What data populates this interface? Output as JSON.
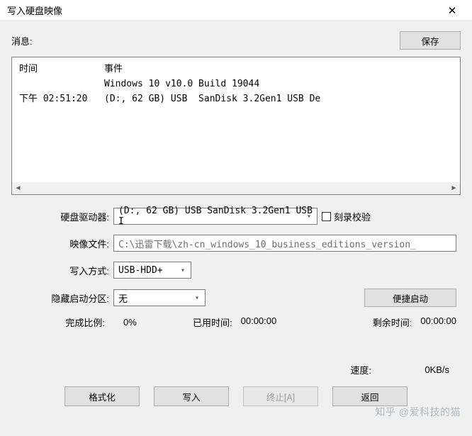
{
  "window": {
    "title": "写入硬盘映像",
    "close_label": "✕"
  },
  "messages": {
    "label": "消息:",
    "save_label": "保存",
    "col_time": "时间",
    "col_event": "事件",
    "rows": [
      {
        "time": "",
        "event": "Windows 10 v10.0 Build 19044"
      },
      {
        "time": "下午 02:51:20",
        "event": "(D:, 62 GB) USB  SanDisk 3.2Gen1 USB De"
      }
    ]
  },
  "form": {
    "drive_label": "硬盘驱动器:",
    "drive_value": "(D:, 62 GB) USB  SanDisk 3.2Gen1 USB I",
    "verify_label": "刻录校验",
    "image_label": "映像文件:",
    "image_value": "C:\\迅雷下载\\zh-cn_windows_10_business_editions_version_",
    "write_mode_label": "写入方式:",
    "write_mode_value": "USB-HDD+",
    "hidden_boot_label": "隐藏启动分区:",
    "hidden_boot_value": "无",
    "quick_boot_label": "便捷启动"
  },
  "status": {
    "progress_label": "完成比例:",
    "progress_value": "0%",
    "elapsed_label": "已用时间:",
    "elapsed_value": "00:00:00",
    "remain_label": "剩余时间:",
    "remain_value": "00:00:00",
    "speed_label": "速度:",
    "speed_value": "0KB/s"
  },
  "buttons": {
    "format": "格式化",
    "write": "写入",
    "abort": "终止[A]",
    "back": "返回"
  },
  "watermark": "知乎 @爱科技的猫"
}
